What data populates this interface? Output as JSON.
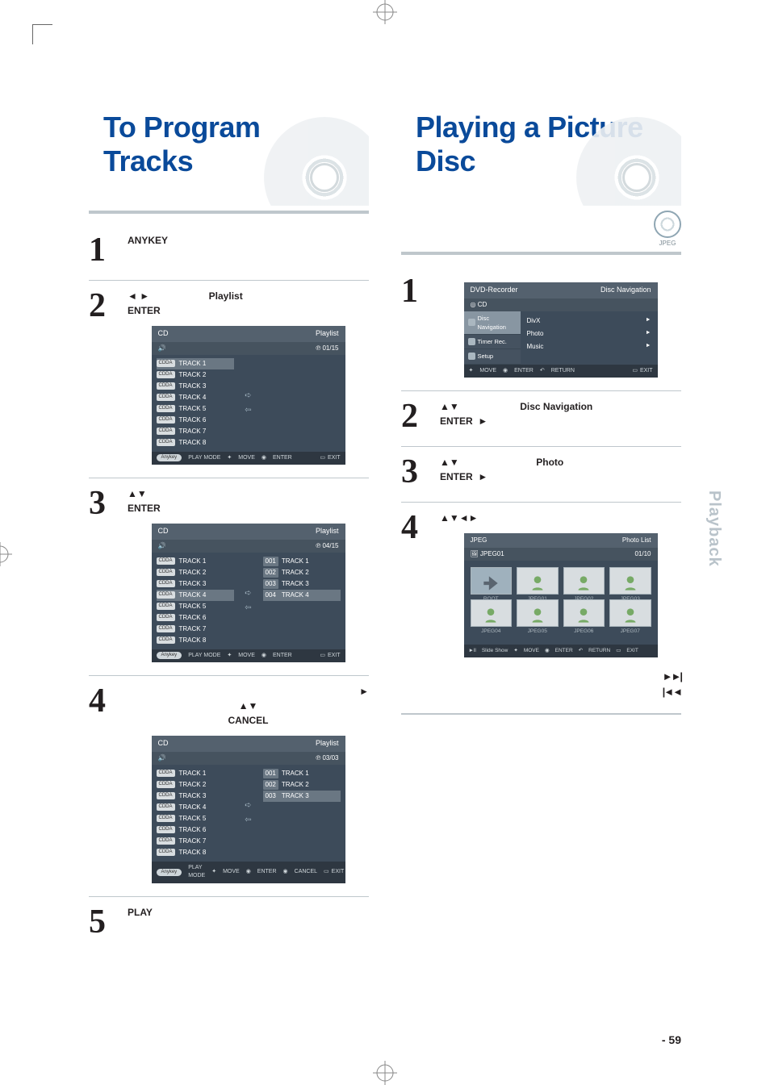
{
  "page_number": "- 59",
  "side_tab": "Playback",
  "left": {
    "title": "To Program Tracks",
    "steps": {
      "s1": {
        "num": "1",
        "anykey": "ANYKEY"
      },
      "s2": {
        "num": "2",
        "arrows": "◄ ►",
        "enter": "ENTER",
        "playlist": "Playlist"
      },
      "s3": {
        "num": "3",
        "arrows": "▲▼",
        "enter": "ENTER"
      },
      "s4": {
        "num": "4",
        "play": "►",
        "arrows": "▲▼",
        "cancel": "CANCEL"
      },
      "s5": {
        "num": "5",
        "play": "PLAY"
      }
    },
    "win1": {
      "hdr_left": "CD",
      "hdr_right": "Playlist",
      "sub_right": "01/15",
      "tracks": [
        "TRACK 1",
        "TRACK 2",
        "TRACK 3",
        "TRACK 4",
        "TRACK 5",
        "TRACK 6",
        "TRACK 7",
        "TRACK 8"
      ],
      "tag": "CDDA",
      "ftr": {
        "anykey": "Anykey",
        "playmode": "PLAY MODE",
        "move": "MOVE",
        "enter": "ENTER",
        "exit": "EXIT"
      }
    },
    "win2": {
      "hdr_left": "CD",
      "hdr_right": "Playlist",
      "sub_right": "04/15",
      "right": [
        {
          "idx": "001",
          "nm": "TRACK 1"
        },
        {
          "idx": "002",
          "nm": "TRACK 2"
        },
        {
          "idx": "003",
          "nm": "TRACK 3"
        },
        {
          "idx": "004",
          "nm": "TRACK 4"
        }
      ]
    },
    "win3": {
      "hdr_left": "CD",
      "hdr_right": "Playlist",
      "sub_right": "03/03",
      "right": [
        {
          "idx": "001",
          "nm": "TRACK 1"
        },
        {
          "idx": "002",
          "nm": "TRACK 2"
        },
        {
          "idx": "003",
          "nm": "TRACK 3"
        }
      ],
      "ftr": {
        "anykey": "Anykey",
        "playmode": "PLAY MODE",
        "move": "MOVE",
        "enter": "ENTER",
        "cancel": "CANCEL",
        "exit": "EXIT"
      }
    }
  },
  "right": {
    "title": "Playing a Picture Disc",
    "badge": "JPEG",
    "steps": {
      "s1": {
        "num": "1"
      },
      "s2": {
        "num": "2",
        "arrows": "▲▼",
        "enter": "ENTER",
        "disc_nav": "Disc Navigation",
        "arr2": "►"
      },
      "s3": {
        "num": "3",
        "arrows": "▲▼",
        "enter": "ENTER",
        "photo": "Photo",
        "arr2": "►"
      },
      "s4": {
        "num": "4",
        "arrows": "▲▼◄►"
      },
      "s5": {
        "next": "►►|",
        "prev": "|◄◄"
      }
    },
    "navwin": {
      "title_left": "DVD-Recorder",
      "title_right": "Disc Navigation",
      "cd": "CD",
      "sidebar": [
        {
          "lbl": "Disc Navigation",
          "sel": true
        },
        {
          "lbl": "Timer Rec.",
          "sel": false
        },
        {
          "lbl": "Setup",
          "sel": false
        }
      ],
      "main": [
        "DivX",
        "Photo",
        "Music"
      ],
      "ftr": {
        "move": "MOVE",
        "enter": "ENTER",
        "return": "RETURN",
        "exit": "EXIT"
      }
    },
    "photowin": {
      "hdr_left": "JPEG",
      "hdr_right": "Photo List",
      "sub_left": "JPEG01",
      "sub_right": "01/10",
      "thumbs": [
        "ROOT",
        "JPEG01",
        "JPEG02",
        "JPEG03",
        "JPEG04",
        "JPEG05",
        "JPEG06",
        "JPEG07"
      ],
      "ftr": {
        "slide": "Slide Show",
        "move": "MOVE",
        "enter": "ENTER",
        "return": "RETURN",
        "exit": "EXIT"
      }
    }
  }
}
